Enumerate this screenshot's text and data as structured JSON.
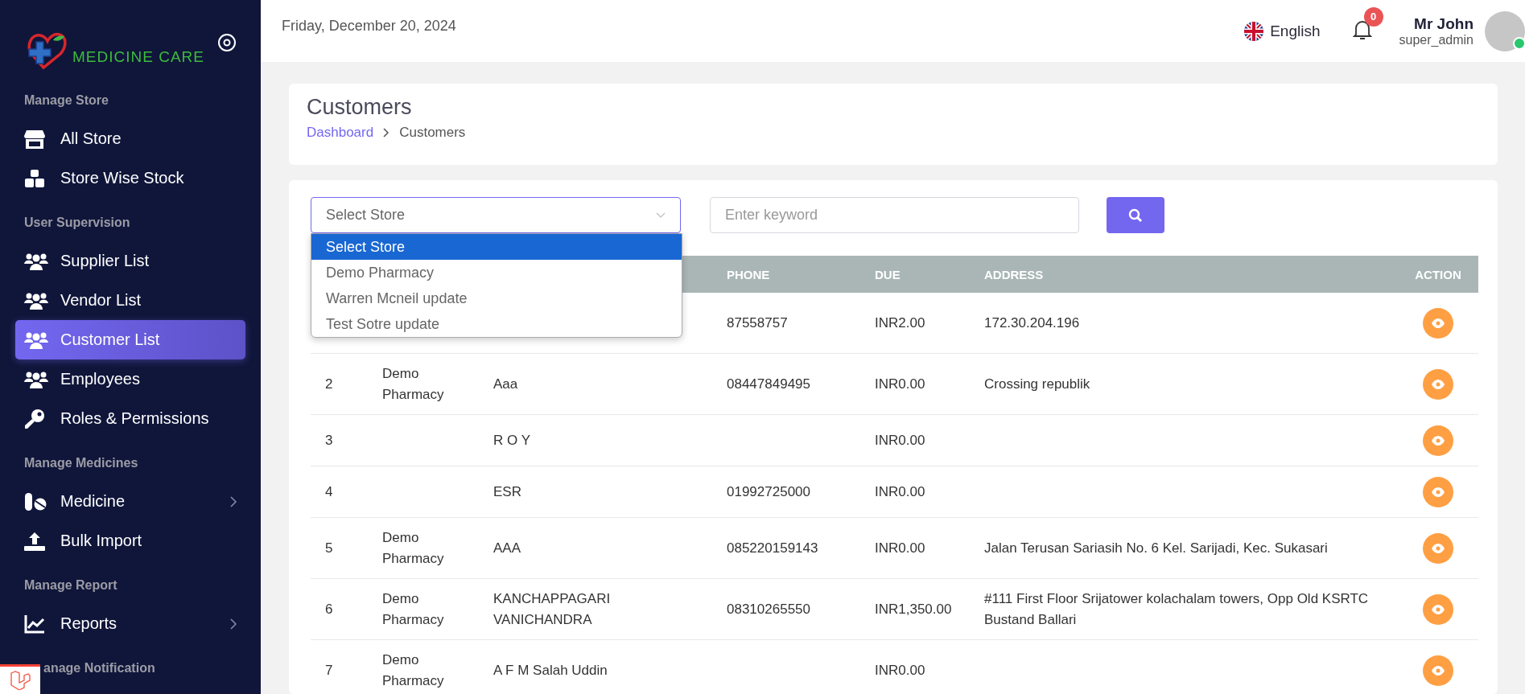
{
  "header": {
    "date": "Friday, December 20, 2024",
    "language": "English",
    "notification_count": "0",
    "user": {
      "name": "Mr John",
      "role": "super_admin",
      "online": true
    }
  },
  "sidebar": {
    "brand": "MEDICINE CARE",
    "items": [
      {
        "kind": "section",
        "label": "Manage Store"
      },
      {
        "kind": "item",
        "label": "All Store",
        "selected": false,
        "submenu": false
      },
      {
        "kind": "item",
        "label": "Store Wise Stock",
        "selected": false,
        "submenu": false
      },
      {
        "kind": "section",
        "label": "User Supervision"
      },
      {
        "kind": "item",
        "label": "Supplier List",
        "selected": false,
        "submenu": false
      },
      {
        "kind": "item",
        "label": "Vendor List",
        "selected": false,
        "submenu": false
      },
      {
        "kind": "item",
        "label": "Customer List",
        "selected": true,
        "submenu": false
      },
      {
        "kind": "item",
        "label": "Employees",
        "selected": false,
        "submenu": false
      },
      {
        "kind": "item",
        "label": "Roles & Permissions",
        "selected": false,
        "submenu": false
      },
      {
        "kind": "section",
        "label": "Manage Medicines"
      },
      {
        "kind": "item",
        "label": "Medicine",
        "selected": false,
        "submenu": true
      },
      {
        "kind": "item",
        "label": "Bulk Import",
        "selected": false,
        "submenu": false
      },
      {
        "kind": "section",
        "label": "Manage Report"
      },
      {
        "kind": "item",
        "label": "Reports",
        "selected": false,
        "submenu": true
      },
      {
        "kind": "section",
        "label": "anage Notification"
      }
    ]
  },
  "page": {
    "title": "Customers",
    "breadcrumbs": [
      {
        "label": "Dashboard",
        "link": true
      },
      {
        "label": "Customers",
        "link": false
      }
    ]
  },
  "filter": {
    "store_select": {
      "value": "Select Store",
      "options": [
        {
          "label": "Select Store",
          "selected": true
        },
        {
          "label": "Demo Pharmacy",
          "selected": false
        },
        {
          "label": "Warren Mcneil update",
          "selected": false
        },
        {
          "label": "Test Sotre update",
          "selected": false
        }
      ]
    },
    "keyword": {
      "placeholder": "Enter keyword"
    }
  },
  "table": {
    "columns": [
      "PHONE",
      "DUE",
      "ADDRESS",
      "ACTION"
    ],
    "rows": [
      {
        "no": "",
        "store": "",
        "name": "",
        "phone": "87558757",
        "due": "INR2.00",
        "address": "172.30.204.196"
      },
      {
        "no": "2",
        "store": "Demo Pharmacy",
        "name": "Aaa",
        "phone": "08447849495",
        "due": "INR0.00",
        "address": "Crossing republik"
      },
      {
        "no": "3",
        "store": "",
        "name": "R O Y",
        "phone": "",
        "due": "INR0.00",
        "address": ""
      },
      {
        "no": "4",
        "store": "",
        "name": "ESR",
        "phone": "01992725000",
        "due": "INR0.00",
        "address": ""
      },
      {
        "no": "5",
        "store": "Demo Pharmacy",
        "name": "AAA",
        "phone": "085220159143",
        "due": "INR0.00",
        "address": "Jalan Terusan Sariasih No. 6 Kel. Sarijadi, Kec. Sukasari"
      },
      {
        "no": "6",
        "store": "Demo Pharmacy",
        "name": "KANCHAPPAGARI VANICHANDRA",
        "phone": "08310265550",
        "due": "INR1,350.00",
        "address": "#111 First Floor Srijatower kolachalam towers, Opp Old KSRTC Bustand Ballari"
      },
      {
        "no": "7",
        "store": "Demo Pharmacy",
        "name": "A F M Salah Uddin",
        "phone": "",
        "due": "INR0.00",
        "address": ""
      }
    ]
  }
}
